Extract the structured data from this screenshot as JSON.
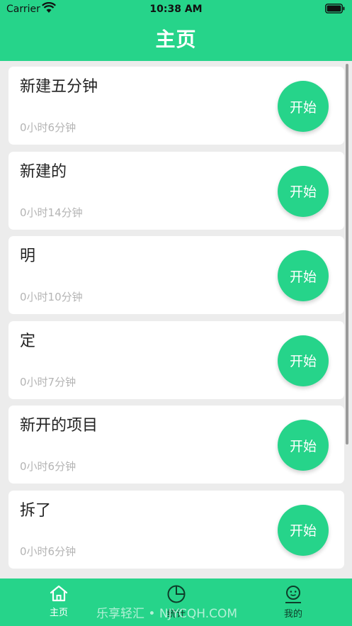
{
  "status_bar": {
    "carrier": "Carrier",
    "time": "10:38 AM"
  },
  "header": {
    "title": "主页"
  },
  "projects": [
    {
      "name": "新建五分钟",
      "duration": "0小时6分钟",
      "action": "开始"
    },
    {
      "name": "新建的",
      "duration": "0小时14分钟",
      "action": "开始"
    },
    {
      "name": "明",
      "duration": "0小时10分钟",
      "action": "开始"
    },
    {
      "name": "定",
      "duration": "0小时7分钟",
      "action": "开始"
    },
    {
      "name": "新开的项目",
      "duration": "0小时6分钟",
      "action": "开始"
    },
    {
      "name": "拆了",
      "duration": "0小时6分钟",
      "action": "开始"
    }
  ],
  "tabbar": {
    "items": [
      {
        "label": "主页",
        "icon": "home-icon",
        "active": true
      },
      {
        "label": "统计",
        "icon": "pie-chart-icon",
        "active": false
      },
      {
        "label": "我的",
        "icon": "profile-icon",
        "active": false
      }
    ]
  },
  "watermark": "乐享轻汇 • NJYCQH.COM",
  "colors": {
    "accent": "#26d48a",
    "background": "#ececec",
    "card": "#ffffff",
    "muted_text": "#b4b4b4"
  }
}
